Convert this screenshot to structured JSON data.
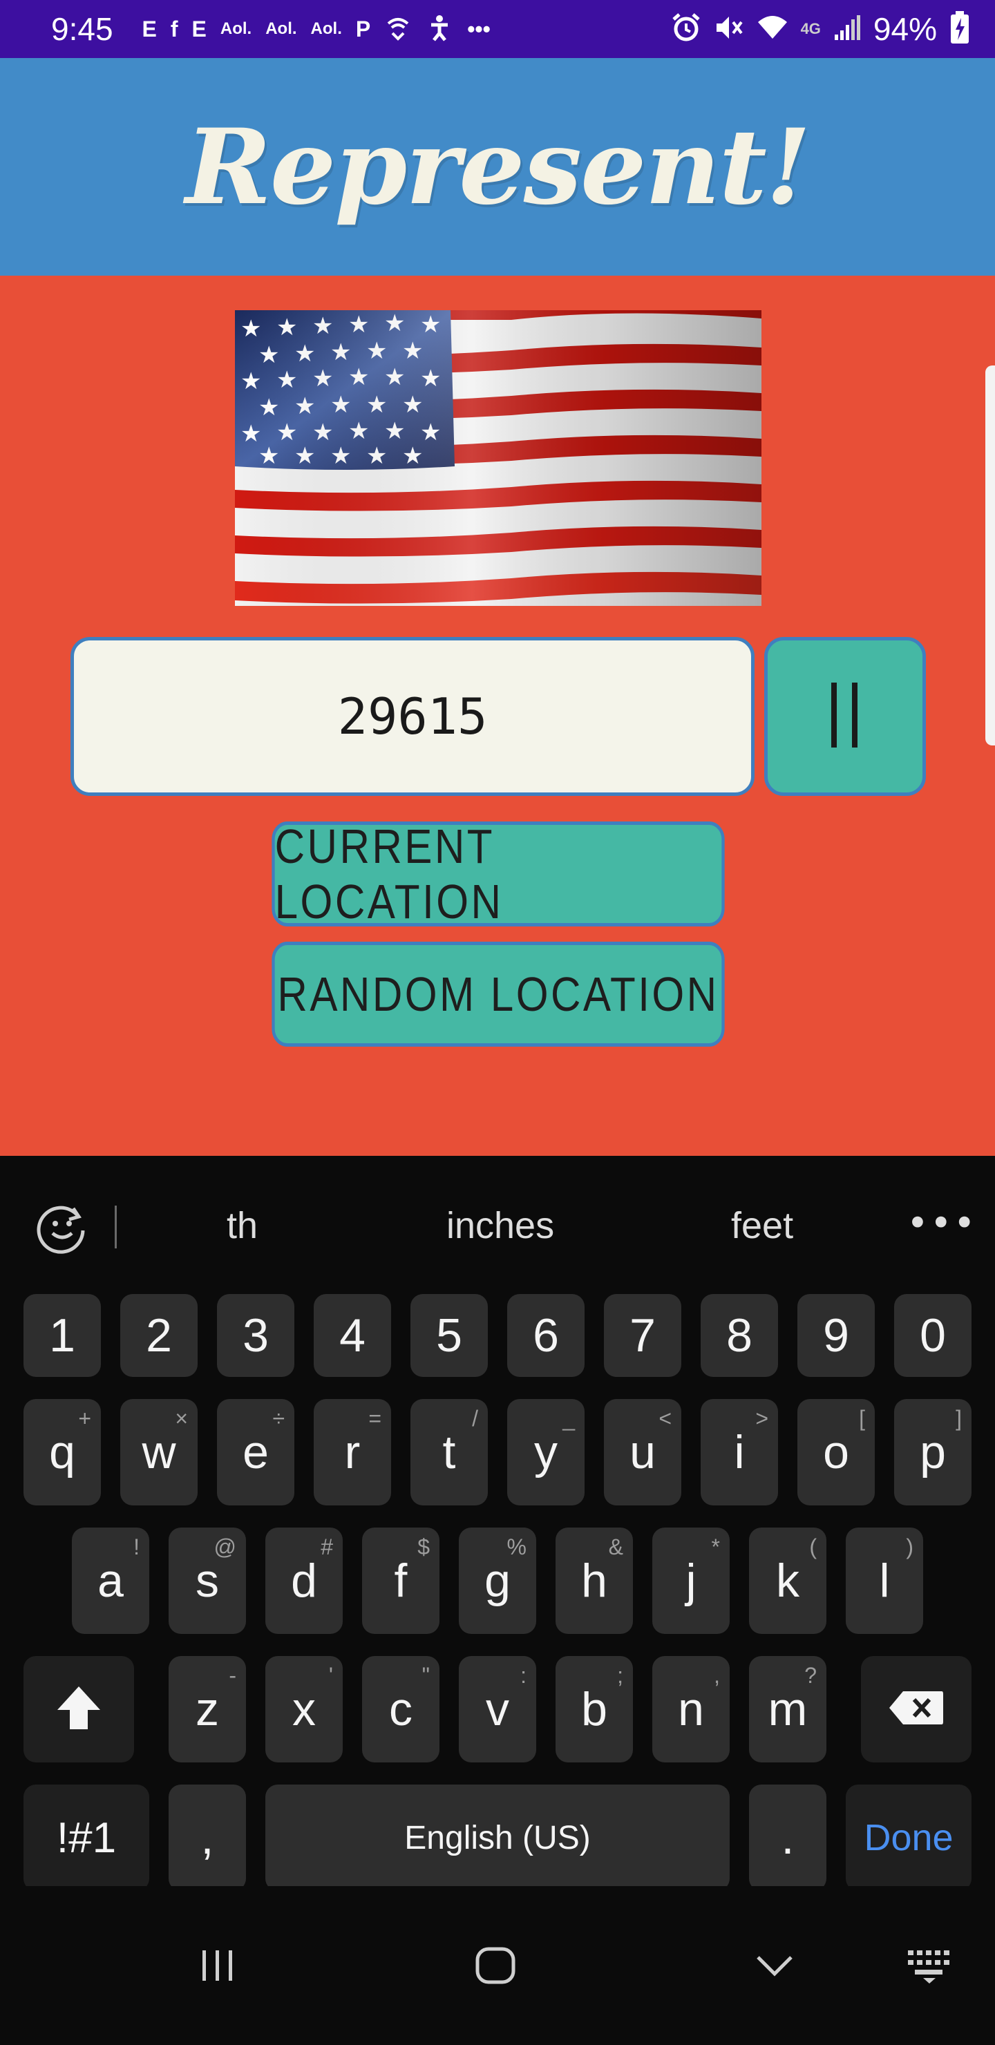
{
  "status_bar": {
    "time": "9:45",
    "notification_icons": [
      "E",
      "f",
      "E",
      "Aol.",
      "Aol.",
      "Aol.",
      "P",
      "wifi-call",
      "accessibility",
      "..."
    ],
    "battery": "94%"
  },
  "header": {
    "title": "Represent!"
  },
  "flag": {
    "icon": "us-flag-image"
  },
  "search": {
    "zip_value": "29615",
    "submit_icon": "submit-arrow-icon"
  },
  "buttons": {
    "current_location": "CURRENT LOCATION",
    "random_location": "RANDOM LOCATION"
  },
  "keyboard": {
    "suggestions": [
      "th",
      "inches",
      "feet"
    ],
    "more": "•••",
    "number_row": [
      "1",
      "2",
      "3",
      "4",
      "5",
      "6",
      "7",
      "8",
      "9",
      "0"
    ],
    "row1": [
      {
        "ch": "q",
        "alt": "+"
      },
      {
        "ch": "w",
        "alt": "×"
      },
      {
        "ch": "e",
        "alt": "÷"
      },
      {
        "ch": "r",
        "alt": "="
      },
      {
        "ch": "t",
        "alt": "/"
      },
      {
        "ch": "y",
        "alt": "_"
      },
      {
        "ch": "u",
        "alt": "<"
      },
      {
        "ch": "i",
        "alt": ">"
      },
      {
        "ch": "o",
        "alt": "["
      },
      {
        "ch": "p",
        "alt": "]"
      }
    ],
    "row2": [
      {
        "ch": "a",
        "alt": "!"
      },
      {
        "ch": "s",
        "alt": "@"
      },
      {
        "ch": "d",
        "alt": "#"
      },
      {
        "ch": "f",
        "alt": "$"
      },
      {
        "ch": "g",
        "alt": "%"
      },
      {
        "ch": "h",
        "alt": "&"
      },
      {
        "ch": "j",
        "alt": "*"
      },
      {
        "ch": "k",
        "alt": "("
      },
      {
        "ch": "l",
        "alt": ")"
      }
    ],
    "row3": [
      {
        "ch": "z",
        "alt": "-"
      },
      {
        "ch": "x",
        "alt": "'"
      },
      {
        "ch": "c",
        "alt": "\""
      },
      {
        "ch": "v",
        "alt": ":"
      },
      {
        "ch": "b",
        "alt": ";"
      },
      {
        "ch": "n",
        "alt": ","
      },
      {
        "ch": "m",
        "alt": "?"
      }
    ],
    "symbols_key": "!#1",
    "comma_key": ",",
    "space_key": "English (US)",
    "period_key": ".",
    "done_key": "Done"
  },
  "colors": {
    "status_bar": "#3d0fa0",
    "header": "#428bc8",
    "main": "#e84f37",
    "button": "#45b8a4",
    "border": "#3f7fbf",
    "input_bg": "#f4f4ea",
    "done_blue": "#4a8ff0"
  }
}
